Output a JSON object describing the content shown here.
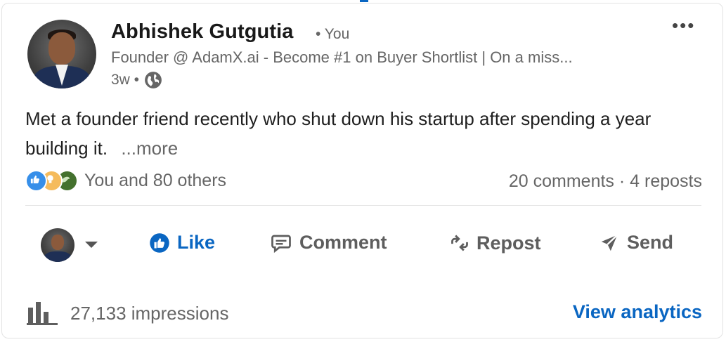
{
  "post": {
    "author": {
      "name": "Abhishek Gutgutia",
      "relation": "• You",
      "headline": "Founder @ AdamX.ai - Become #1 on Buyer Shortlist | On a miss...",
      "time": "3w •"
    },
    "text": "Met a founder friend recently who shut down his startup after spending a year building it.",
    "see_more": "...more"
  },
  "social": {
    "reactions_text": "You and 80 others",
    "comments_reposts": "20 comments · 4 reposts",
    "reaction_icons": [
      "like-icon",
      "insightful-icon",
      "support-icon"
    ]
  },
  "actions": {
    "like": "Like",
    "comment": "Comment",
    "repost": "Repost",
    "send": "Send"
  },
  "footer": {
    "impressions": "27,133 impressions",
    "analytics": "View analytics"
  },
  "colors": {
    "accent": "#0a66c2",
    "muted_text": "#666666"
  }
}
